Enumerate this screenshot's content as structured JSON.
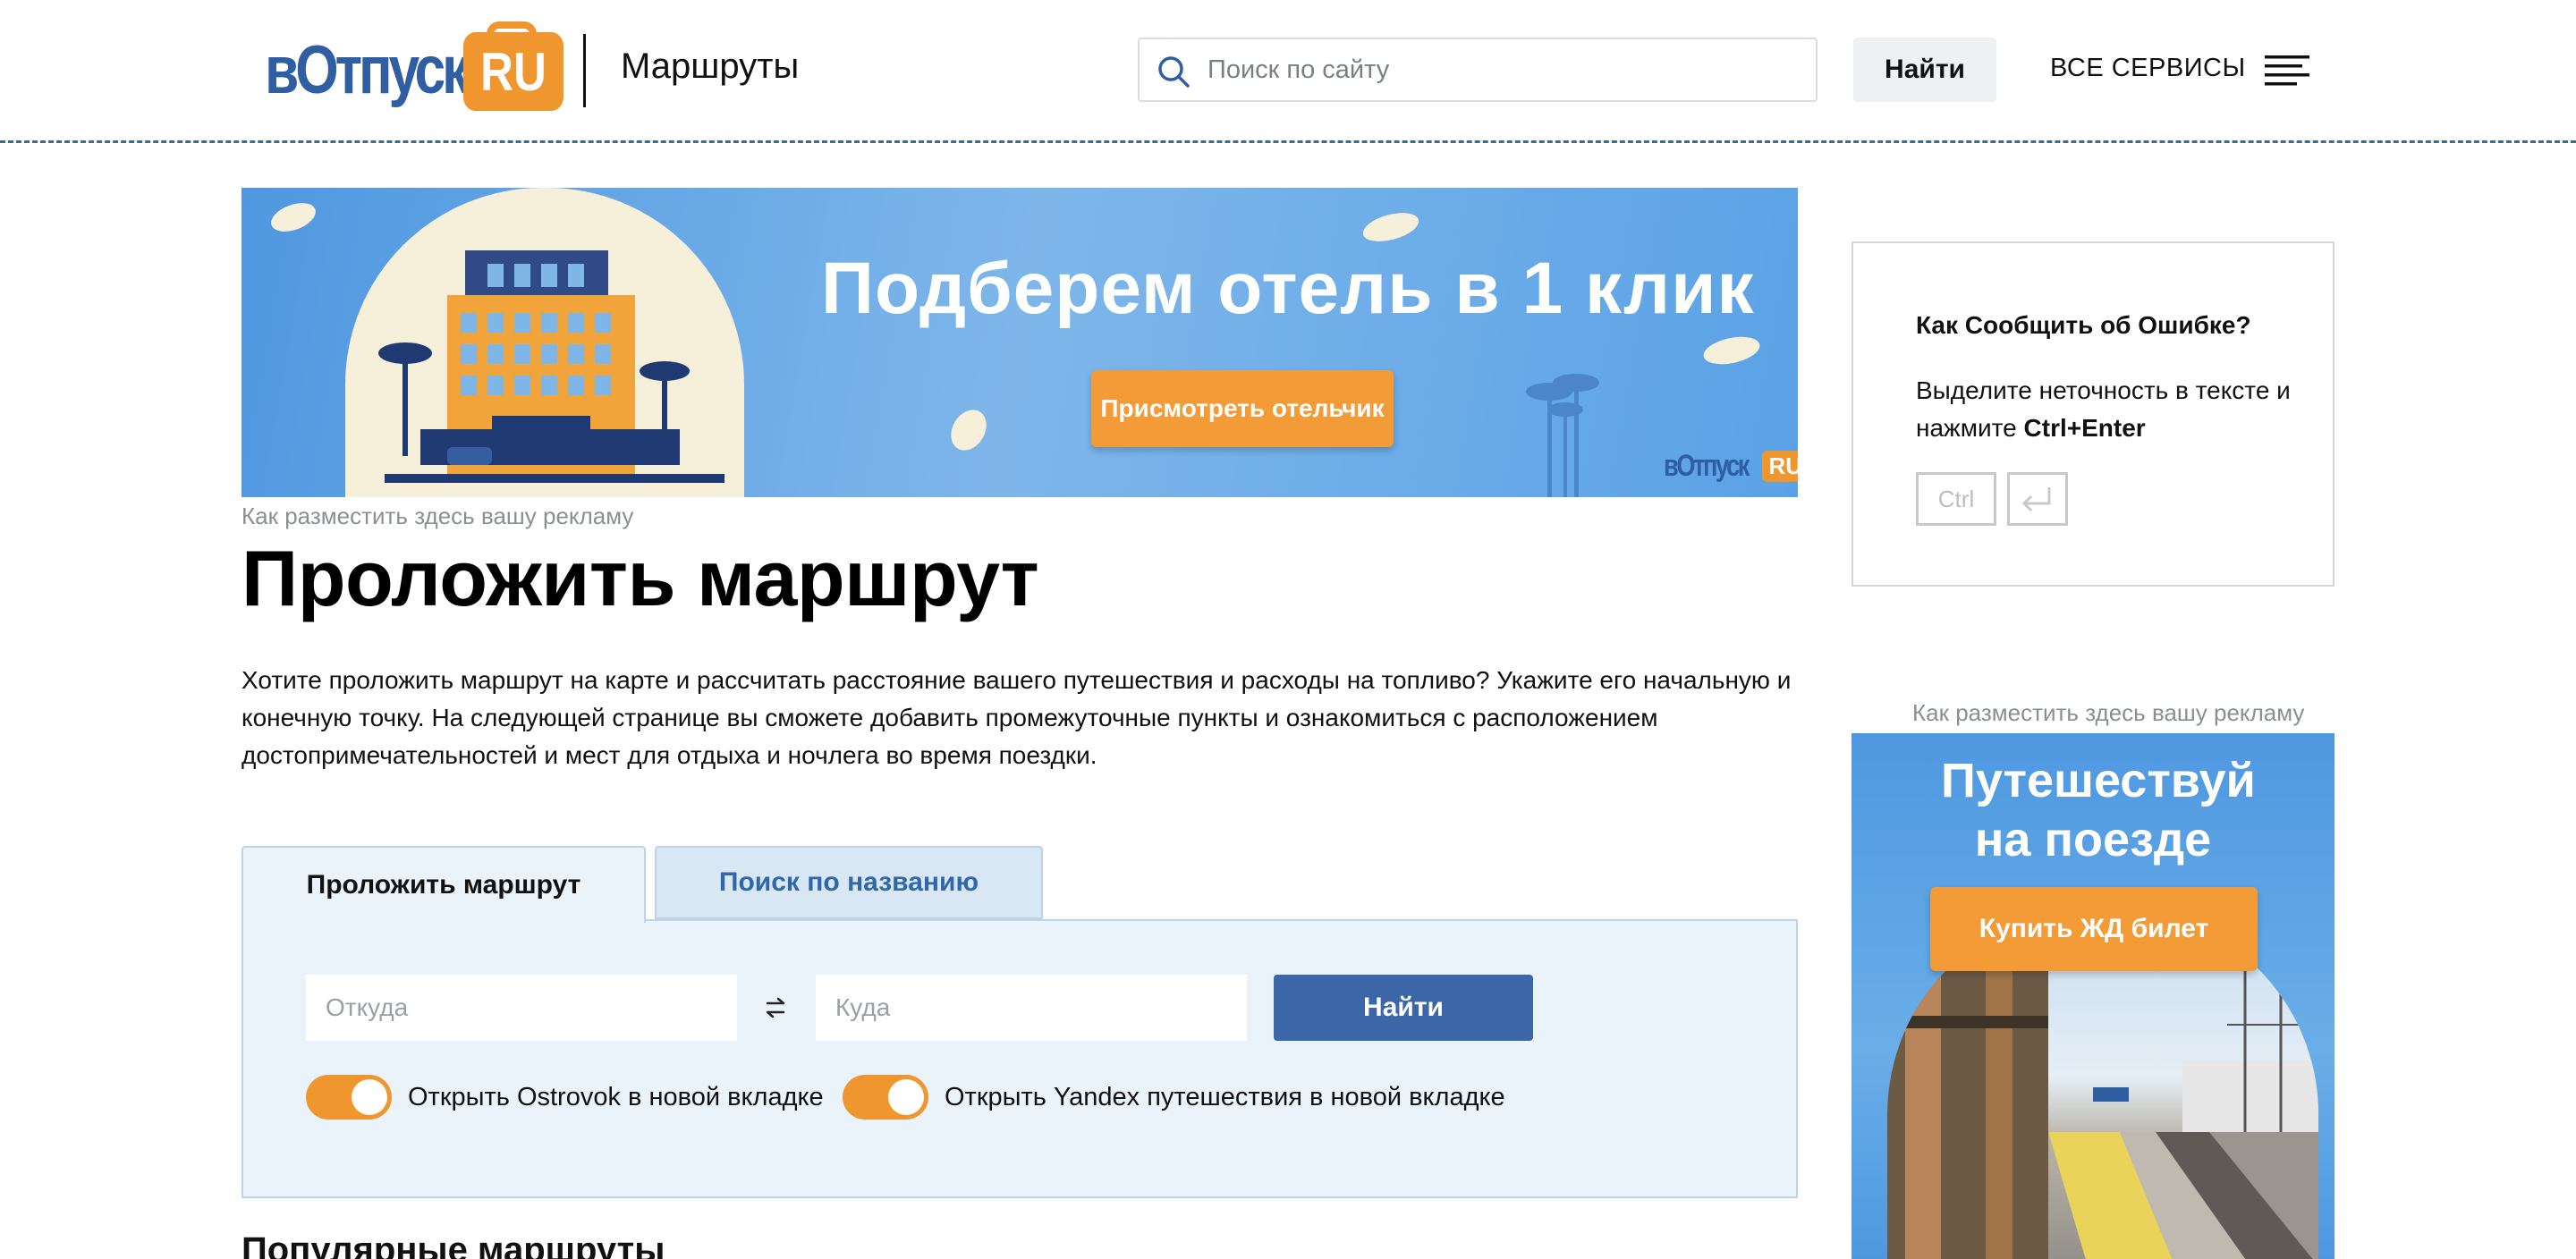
{
  "header": {
    "logo_text": "вОтпуск",
    "logo_badge": "RU",
    "section_title": "Маршруты",
    "search_placeholder": "Поиск по сайту",
    "search_button": "Найти",
    "services_label": "ВСЕ СЕРВИСЫ"
  },
  "banner": {
    "title": "Подберем отель в 1 клик",
    "button": "Присмотреть отельчик",
    "logo_text": "вОтпуск",
    "logo_badge": "RU",
    "ad_note": "Как разместить здесь вашу рекламу"
  },
  "main": {
    "title": "Проложить маршрут",
    "intro": "Хотите проложить маршрут на карте и рассчитать расстояние вашего путешествия и расходы на топливо? Укажите его начальную и конечную точку. На следующей странице вы сможете добавить промежуточные пункты и ознакомиться с расположением достопримечательностей и мест для отдыха и ночлега во время поездки.",
    "tabs": [
      {
        "label": "Проложить маршрут",
        "active": true
      },
      {
        "label": "Поиск по названию",
        "active": false
      }
    ],
    "from_placeholder": "Откуда",
    "to_placeholder": "Куда",
    "submit_button": "Найти",
    "toggles": [
      {
        "label": "Открыть Ostrovok в новой вкладке",
        "on": true
      },
      {
        "label": "Открыть Yandex путешествия в новой вкладке",
        "on": true
      }
    ],
    "popular_heading": "Популярные маршруты"
  },
  "sidebar": {
    "error_title": "Как Сообщить об Ошибке?",
    "error_text": "Выделите неточность в тексте и нажмите",
    "error_keys": "Ctrl+Enter",
    "key_ctrl": "Ctrl",
    "ad_note": "Как разместить здесь вашу рекламу",
    "train_title": "Путешествуй на поезде",
    "train_button": "Купить ЖД билет"
  },
  "colors": {
    "brand_blue": "#2f5ea3",
    "brand_orange": "#f0962e",
    "button_blue": "#3b67a8",
    "panel_bg": "#eaf2fa"
  }
}
